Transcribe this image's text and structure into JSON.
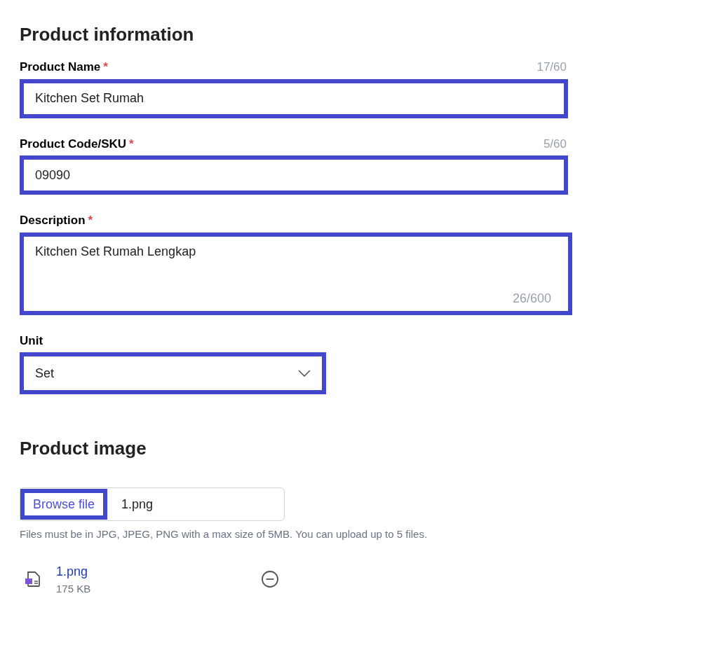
{
  "info_section": {
    "title": "Product information",
    "fields": [
      {
        "kind": "text",
        "label": "Product Name",
        "required_mark": "*",
        "counter": "17/60",
        "value": "Kitchen Set Rumah"
      },
      {
        "kind": "text",
        "label": "Product Code/SKU",
        "required_mark": "*",
        "counter": "5/60",
        "value": "09090"
      },
      {
        "kind": "textarea",
        "label": "Description",
        "required_mark": "*",
        "counter": "26/600",
        "value": "Kitchen Set Rumah Lengkap"
      },
      {
        "kind": "select",
        "label": "Unit",
        "value": "Set"
      }
    ]
  },
  "image_section": {
    "title": "Product image",
    "browse_button": "Browse file",
    "chosen_file": "1.png",
    "help_text": "Files must be in JPG, JPEG, PNG with a max size of 5MB. You can upload up to 5 files.",
    "files": [
      {
        "name": "1.png",
        "size": "175 KB"
      }
    ]
  }
}
